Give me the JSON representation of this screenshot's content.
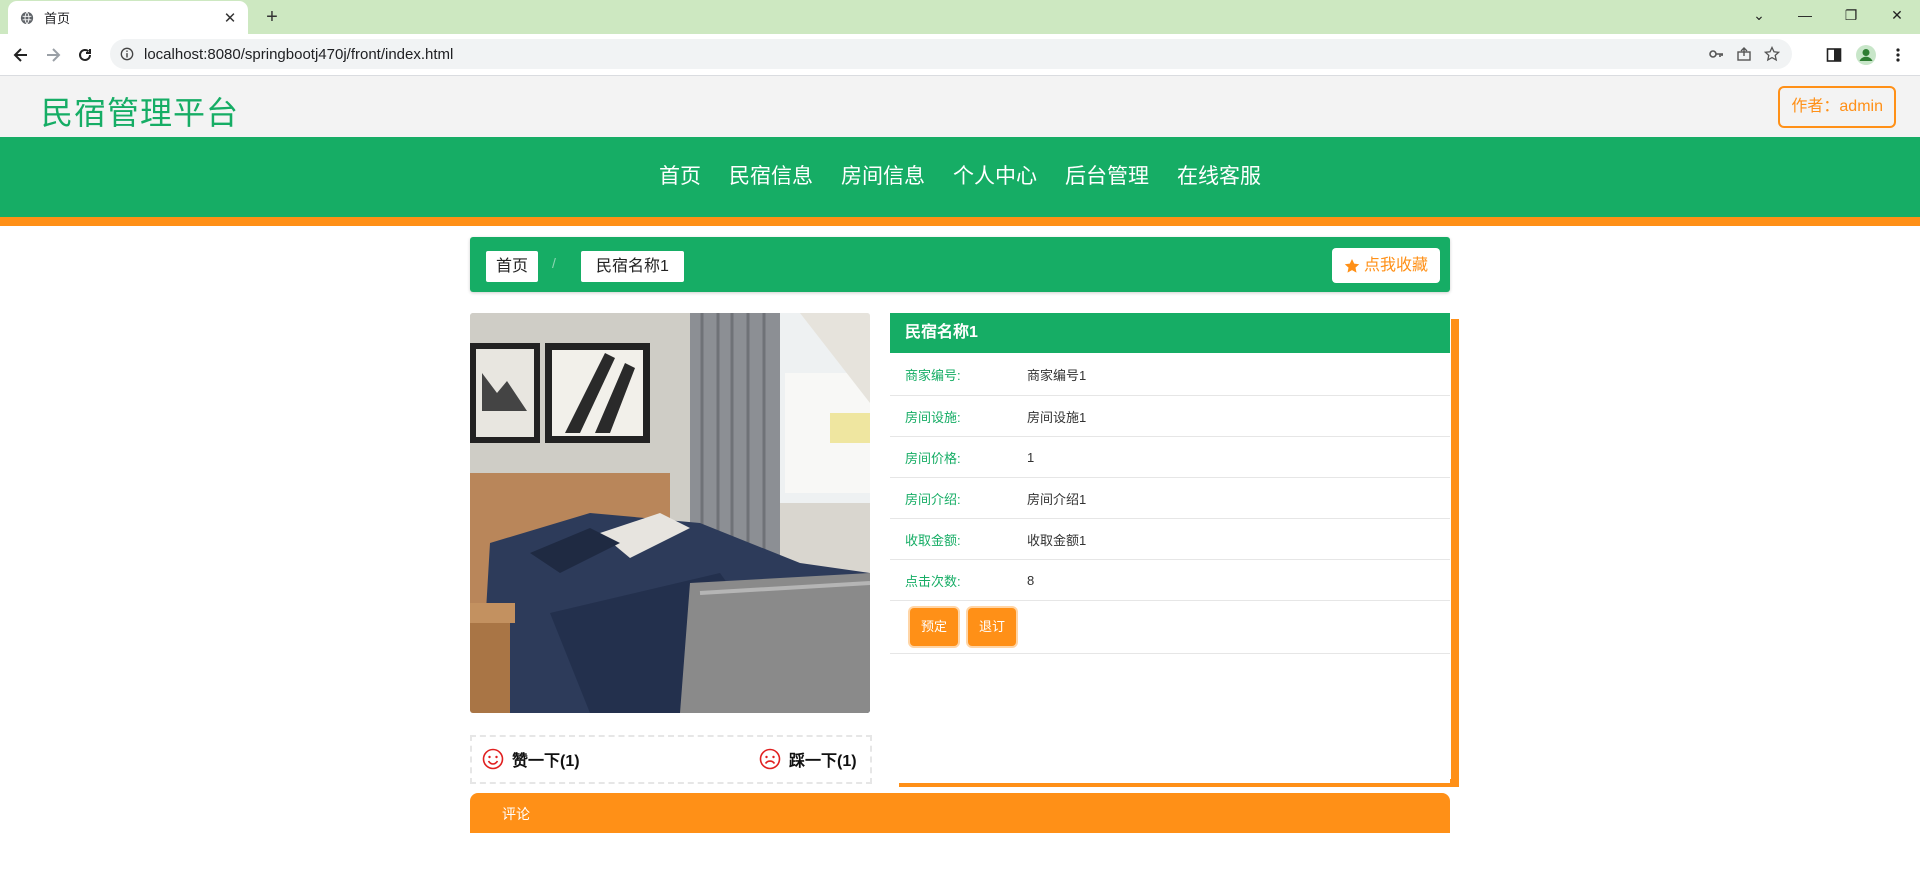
{
  "browser": {
    "tab_title": "首页",
    "url": "localhost:8080/springbootj470j/front/index.html"
  },
  "site": {
    "logo": "民宿管理平台",
    "author": "作者：admin",
    "nav": [
      "首页",
      "民宿信息",
      "房间信息",
      "个人中心",
      "后台管理",
      "在线客服"
    ]
  },
  "breadcrumb": {
    "home": "首页",
    "separator": "/",
    "current": "民宿名称1",
    "favorite": "点我收藏"
  },
  "votes": {
    "like": "赞一下(1)",
    "dislike": "踩一下(1)"
  },
  "detail": {
    "title": "民宿名称1",
    "rows": [
      {
        "label": "商家编号:",
        "value": "商家编号1"
      },
      {
        "label": "房间设施:",
        "value": "房间设施1"
      },
      {
        "label": "房间价格:",
        "value": "1"
      },
      {
        "label": "房间介绍:",
        "value": "房间介绍1"
      },
      {
        "label": "收取金额:",
        "value": "收取金额1"
      },
      {
        "label": "点击次数:",
        "value": "8"
      }
    ],
    "book": "预定",
    "cancel": "退订"
  },
  "comment": {
    "label": "评论"
  },
  "colors": {
    "green": "#16ad65",
    "orange": "#ff9017"
  }
}
